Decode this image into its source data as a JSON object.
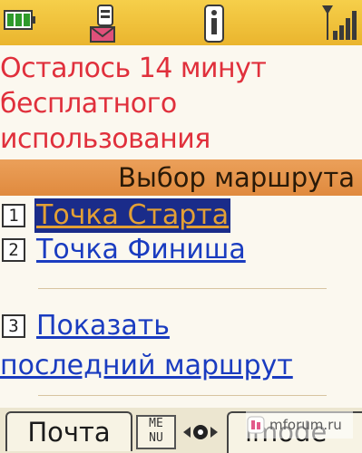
{
  "status": {
    "battery_icon": "battery-full-icon",
    "icons": [
      "mail-icon",
      "i-appli-icon",
      "signal-antenna-icon"
    ]
  },
  "notice": {
    "lines": [
      "Осталось 14 минут",
      "бесплатного",
      "использования"
    ]
  },
  "title": "Выбор маршрута",
  "menu": {
    "items": [
      {
        "key": "1",
        "label": "Точка Старта",
        "selected": true
      },
      {
        "key": "2",
        "label": "Точка Финиша",
        "selected": false
      },
      {
        "key": "3",
        "label_line1": "Показать",
        "label_line2": "последний маршрут",
        "selected": false
      }
    ]
  },
  "softkeys": {
    "left": "Почта",
    "menu_line1": "ME",
    "menu_line2": "NU",
    "right": "imode"
  },
  "watermark": "mforum.ru",
  "colors": {
    "status_bar": "#eab52e",
    "notice_text": "#e0303c",
    "title_bar": "#e08a3e",
    "link": "#1a3cc0",
    "selected_bg": "#1a2c8a",
    "selected_text": "#e3a035"
  }
}
